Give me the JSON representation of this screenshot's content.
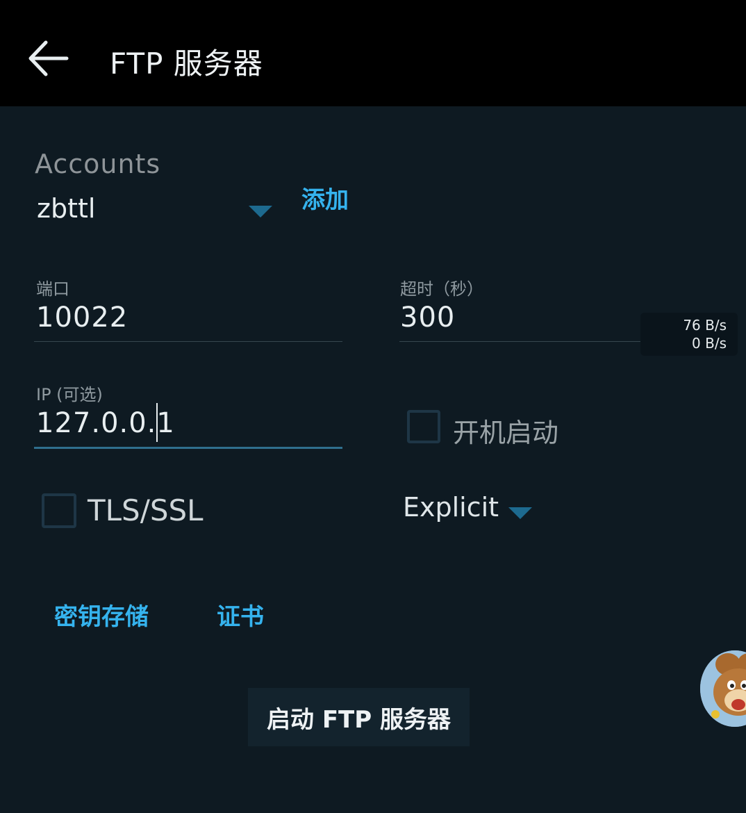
{
  "header": {
    "title": "FTP 服务器"
  },
  "accounts": {
    "label": "Accounts",
    "selected": "zbttl",
    "add_label": "添加"
  },
  "port": {
    "label": "端口",
    "value": "10022"
  },
  "timeout": {
    "label": "超时（秒）",
    "value": "300"
  },
  "ip": {
    "label": "IP (可选)",
    "value": "127.0.0.1"
  },
  "autostart": {
    "label": "开机启动",
    "checked": false
  },
  "tls": {
    "label": "TLS/SSL",
    "checked": false,
    "mode": "Explicit"
  },
  "links": {
    "keystore": "密钥存储",
    "certificate": "证书"
  },
  "start_button": "启动 FTP 服务器",
  "speed": {
    "upload": "76 B/s",
    "download": "0 B/s"
  },
  "colors": {
    "accent": "#35b3ee",
    "background": "#0e1a22",
    "header": "#000000"
  }
}
